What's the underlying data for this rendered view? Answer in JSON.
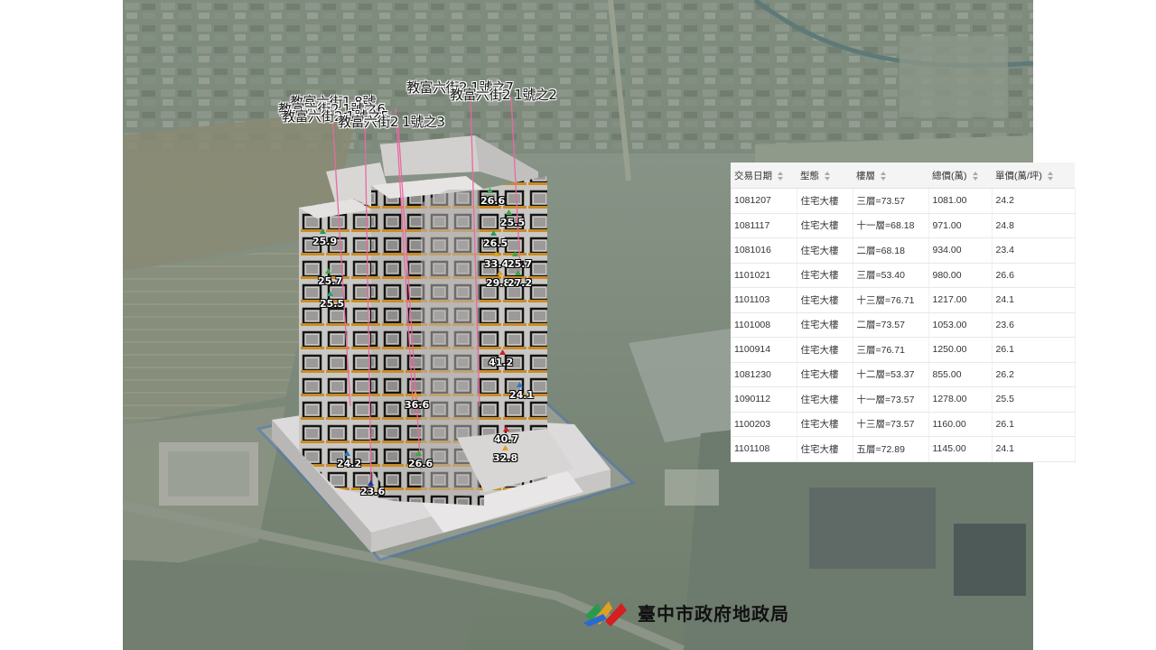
{
  "address_labels": [
    "教富六街2 1號之7",
    "教富六街2 1號之2",
    "教富六街1 8號",
    "教富六街2 1號之6",
    "教富六街2 1號之5",
    "教富六街2 1號之3"
  ],
  "price_markers": [
    {
      "value": "26.6",
      "color": "#3aa845"
    },
    {
      "value": "25.5",
      "color": "#3aa845"
    },
    {
      "value": "25.9",
      "color": "#2a9a5a"
    },
    {
      "value": "26.5",
      "color": "#2a9a5a"
    },
    {
      "value": "33.4",
      "color": "#e0a020"
    },
    {
      "value": "25.7",
      "color": "#3aa845"
    },
    {
      "value": "25.7",
      "color": "#3aa845"
    },
    {
      "value": "29.8",
      "color": "#e0a020"
    },
    {
      "value": "27.2",
      "color": "#3aa845"
    },
    {
      "value": "25.5",
      "color": "#2aa070"
    },
    {
      "value": "41.2",
      "color": "#d42020"
    },
    {
      "value": "24.1",
      "color": "#2a7ac8"
    },
    {
      "value": "36.6",
      "color": "#e0a020"
    },
    {
      "value": "40.7",
      "color": "#d42020"
    },
    {
      "value": "24.2",
      "color": "#2a7ac8"
    },
    {
      "value": "26.6",
      "color": "#3aa845"
    },
    {
      "value": "32.8",
      "color": "#e0a020"
    },
    {
      "value": "23.6",
      "color": "#1a3a9a"
    }
  ],
  "table": {
    "headers": [
      "交易日期",
      "型態",
      "樓層",
      "總價(萬)",
      "單價(萬/坪)"
    ],
    "rows": [
      [
        "1081207",
        "住宅大樓",
        "三層=73.57",
        "1081.00",
        "24.2"
      ],
      [
        "1081117",
        "住宅大樓",
        "十一層=68.18",
        "971.00",
        "24.8"
      ],
      [
        "1081016",
        "住宅大樓",
        "二層=68.18",
        "934.00",
        "23.4"
      ],
      [
        "1101021",
        "住宅大樓",
        "三層=53.40",
        "980.00",
        "26.6"
      ],
      [
        "1101103",
        "住宅大樓",
        "十三層=76.71",
        "1217.00",
        "24.1"
      ],
      [
        "1101008",
        "住宅大樓",
        "二層=73.57",
        "1053.00",
        "23.6"
      ],
      [
        "1100914",
        "住宅大樓",
        "三層=76.71",
        "1250.00",
        "26.1"
      ],
      [
        "1081230",
        "住宅大樓",
        "十二層=53.37",
        "855.00",
        "26.2"
      ],
      [
        "1090112",
        "住宅大樓",
        "十一層=73.57",
        "1278.00",
        "25.5"
      ],
      [
        "1100203",
        "住宅大樓",
        "十三層=73.57",
        "1160.00",
        "26.1"
      ],
      [
        "1101108",
        "住宅大樓",
        "五層=72.89",
        "1145.00",
        "24.1"
      ]
    ]
  },
  "logo": {
    "text": "臺中市政府地政局",
    "icon": "land-administration-logo-icon"
  },
  "colors": {
    "parcel_outline": "#3a6fd8",
    "building_wall": "#c9c7c4",
    "window_frame": "#1a1a1a",
    "aerial_base": "#7b8a78"
  }
}
